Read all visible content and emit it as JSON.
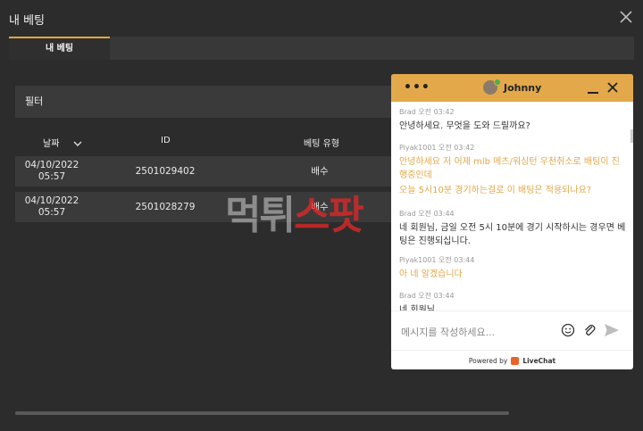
{
  "window": {
    "title": "내 베팅"
  },
  "tabs": [
    {
      "label": "내 베팅",
      "active": true
    }
  ],
  "filter": {
    "label": "필터"
  },
  "table": {
    "headers": {
      "date": "날짜",
      "id": "ID",
      "type": "베팅 유형"
    },
    "rows": [
      {
        "date": "04/10/2022 05:57",
        "id": "2501029402",
        "type": "배수"
      },
      {
        "date": "04/10/2022 05:57",
        "id": "2501028279",
        "type": "배수"
      }
    ]
  },
  "watermark": {
    "part1": "먹튀",
    "part2": "스팟"
  },
  "chat": {
    "agent_name": "Johnny",
    "menu_icon": "dots-icon",
    "messages": [
      {
        "meta": "Brad 오전 03:42",
        "text": "안녕하세요. 무엇을 도와 드릴까요?",
        "style": "agent"
      },
      {
        "meta": "Piyak1001 오전 03:42",
        "text": "안녕하세요 저 어제 mlb 메츠/워싱턴 우천취소로 배팅이 진행중인데",
        "text2": "오늘 5시10분 경기하는걸로 이 배팅은 적용되나요?",
        "style": "user"
      },
      {
        "meta": "Brad 오전 03:44",
        "text": "네 회원님, 금일 오전 5시 10분에 경기 시작하시는 경우면 베팅은 진행되십니다.",
        "style": "agent"
      },
      {
        "meta": "Piyak1001 오전 03:44",
        "text": "아 네 알겠습니다",
        "style": "user"
      },
      {
        "meta": "Brad 오전 03:44",
        "text": "네 회원님",
        "style": "agent"
      }
    ],
    "input_placeholder": "메시지를 작성하세요...",
    "powered_by": "Powered by",
    "brand": "LiveChat",
    "colors": {
      "header": "#e2a84a",
      "user_text": "#e2a84a",
      "brand": "#e8632a"
    }
  }
}
